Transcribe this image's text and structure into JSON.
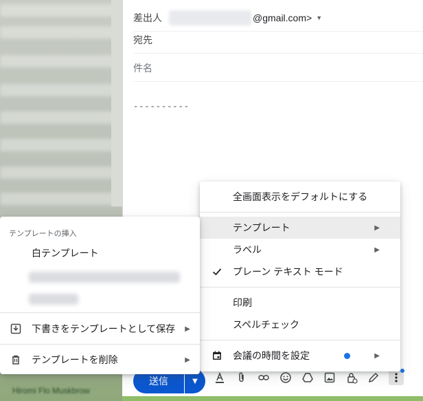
{
  "compose": {
    "from_label": "差出人",
    "from_email_suffix": "@gmail.com>",
    "to_label": "宛先",
    "subject_placeholder": "件名",
    "signature": "----------"
  },
  "toolbar": {
    "send_label": "送信",
    "icons": [
      "format-text-icon",
      "attach-icon",
      "link-icon",
      "emoji-icon",
      "drive-icon",
      "photo-icon",
      "confidential-icon",
      "signature-icon",
      "more-options-icon"
    ]
  },
  "main_menu": {
    "items": [
      {
        "label": "全画面表示をデフォルトにする"
      },
      {
        "label": "テンプレート",
        "has_submenu": true,
        "highlighted": true
      },
      {
        "label": "ラベル",
        "has_submenu": true
      },
      {
        "label": "プレーン テキスト モード",
        "checked": true
      },
      {
        "label": "印刷"
      },
      {
        "label": "スペルチェック"
      },
      {
        "label": "会議の時間を設定",
        "icon": "calendar-icon",
        "has_submenu": true,
        "badge_color": "#1a73e8"
      }
    ]
  },
  "template_menu": {
    "section_title": "テンプレートの挿入",
    "template_name": "白テンプレート",
    "save_label": "下書きをテンプレートとして保存",
    "delete_label": "テンプレートを削除"
  },
  "background": {
    "footer_text": "Hiromi Flo Muskbrow"
  },
  "colors": {
    "accent": "#0b57d0",
    "highlight": "#ececec",
    "dot": "#1a73e8"
  }
}
